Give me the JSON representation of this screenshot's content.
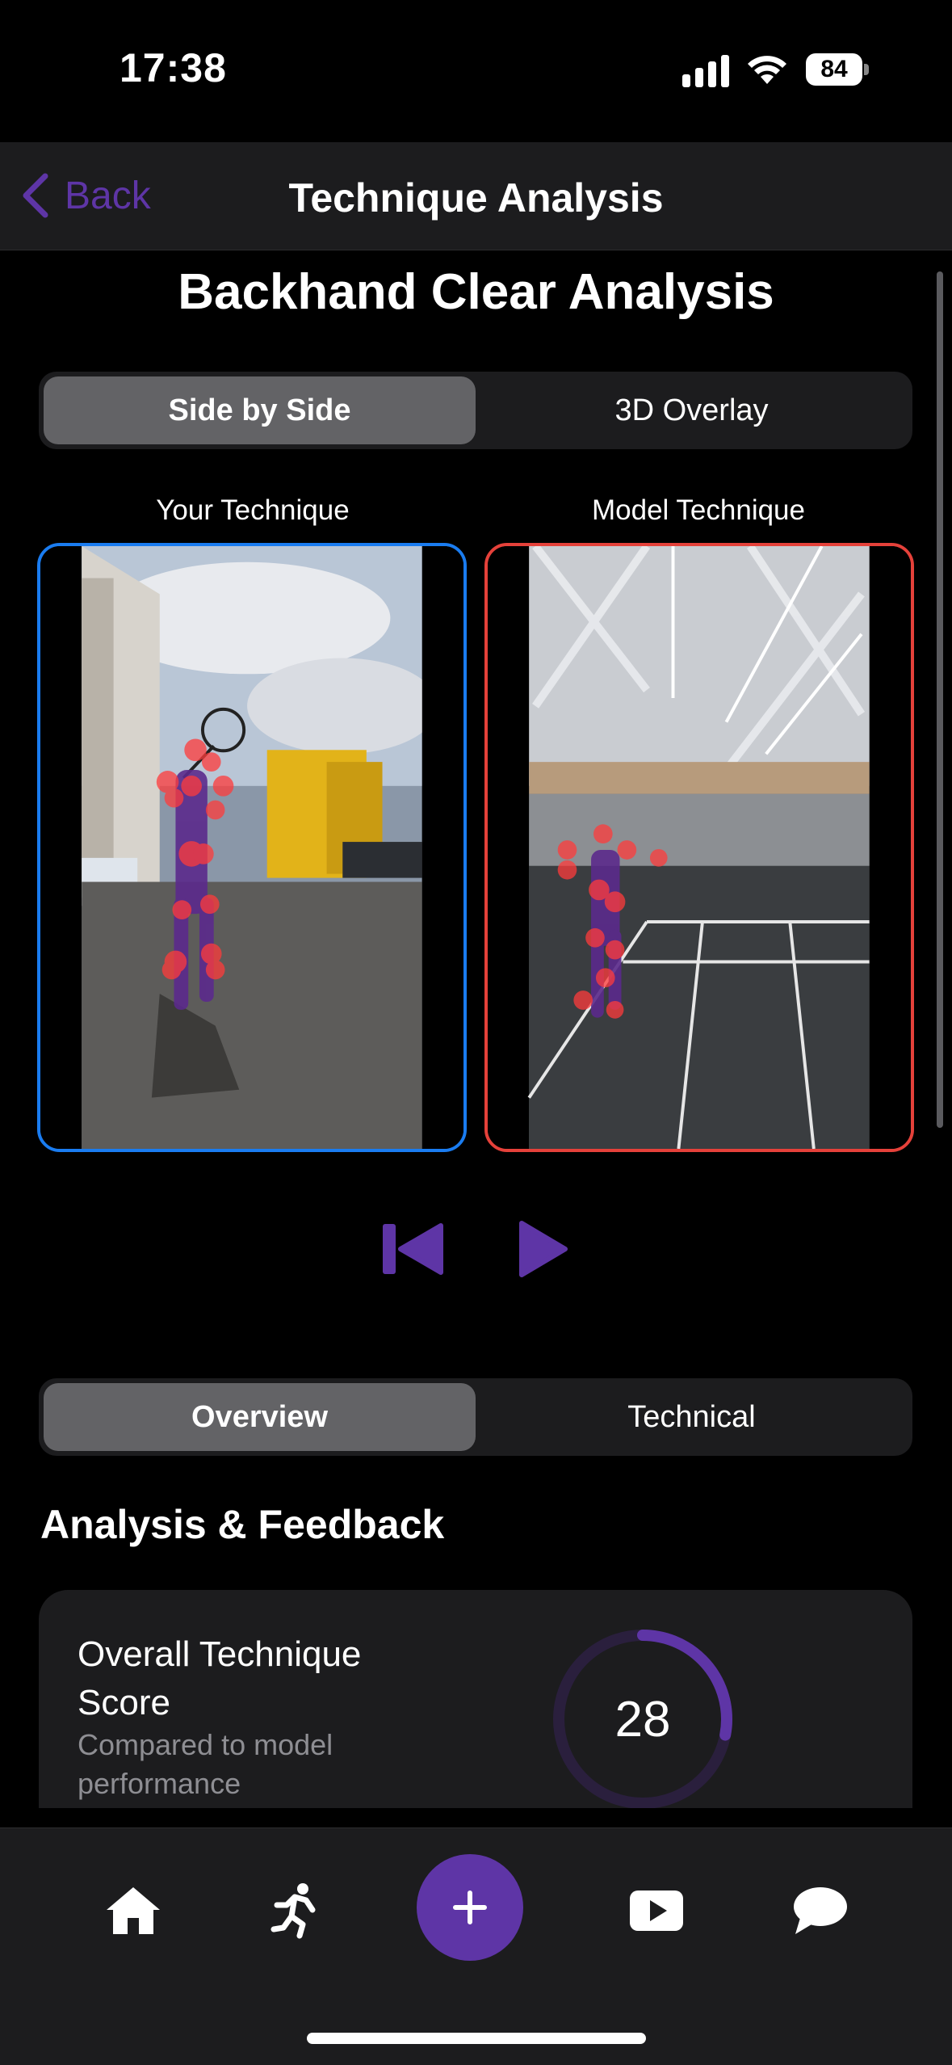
{
  "status_bar": {
    "time": "17:38",
    "battery": "84"
  },
  "nav": {
    "back_label": "Back",
    "title": "Technique Analysis"
  },
  "page_heading": "Backhand Clear Analysis",
  "view_mode": {
    "options": [
      "Side by Side",
      "3D Overlay"
    ],
    "selected": "Side by Side"
  },
  "videos": {
    "user": {
      "label": "Your Technique",
      "border_color": "#1a7cf0"
    },
    "model": {
      "label": "Model Technique",
      "border_color": "#e5413a"
    }
  },
  "player_controls": {
    "rewind_icon": "skip-back-icon",
    "play_icon": "play-icon",
    "accent": "#5e35a6"
  },
  "detail_tabs": {
    "options": [
      "Overview",
      "Technical"
    ],
    "selected": "Overview"
  },
  "analysis": {
    "section_title": "Analysis & Feedback",
    "score_title": "Overall Technique Score",
    "score_subtitle": "Compared to model performance",
    "score_value": "28",
    "score_fraction": 0.28
  },
  "tab_bar": {
    "items": [
      "home-icon",
      "running-icon",
      "add-icon",
      "video-icon",
      "chat-icon"
    ]
  },
  "colors": {
    "accent": "#5e35a6",
    "background": "#000000",
    "surface": "#1c1c1e"
  }
}
